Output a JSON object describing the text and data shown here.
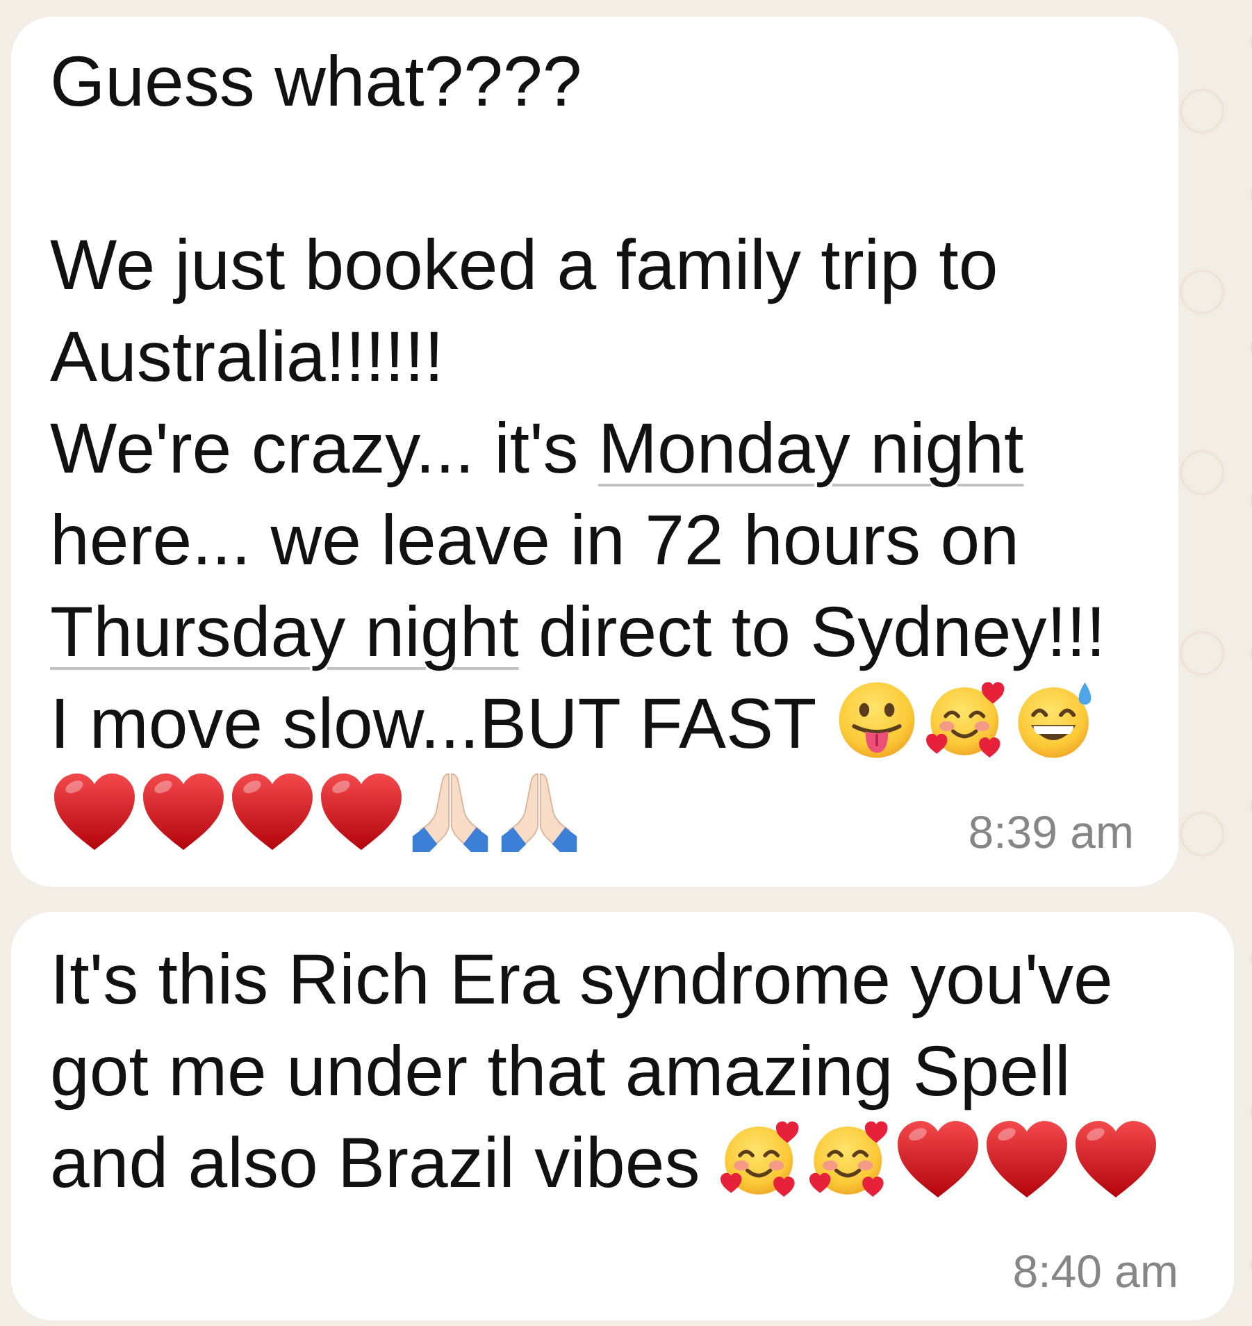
{
  "messages": [
    {
      "paragraphs": [
        {
          "parts": [
            {
              "kind": "text",
              "text": "Guess what????\n\nWe just booked a family trip to Australia!!!!!!\nWe're crazy... it's "
            },
            {
              "kind": "link",
              "text": "Monday night"
            },
            {
              "kind": "text",
              "text": " here... we leave in 72 hours on "
            },
            {
              "kind": "link",
              "text": "Thursday night"
            },
            {
              "kind": "text",
              "text": " direct to Sydney!!!\nI move slow...BUT FAST"
            },
            {
              "kind": "tongue"
            },
            {
              "kind": "hearts"
            },
            {
              "kind": "sweat"
            }
          ]
        },
        {
          "parts": [
            {
              "kind": "heart"
            },
            {
              "kind": "heart"
            },
            {
              "kind": "heart"
            },
            {
              "kind": "heart"
            },
            {
              "kind": "hands"
            },
            {
              "kind": "hands"
            }
          ]
        }
      ],
      "time": "8:39 am"
    },
    {
      "paragraphs": [
        {
          "parts": [
            {
              "kind": "text",
              "text": "It's this Rich Era syndrome you've got me under that amazing Spell and also Brazil vibes"
            },
            {
              "kind": "hearts"
            },
            {
              "kind": "hearts"
            },
            {
              "kind": "heart"
            },
            {
              "kind": "heart"
            },
            {
              "kind": "heart"
            }
          ]
        }
      ],
      "time": "8:40 am"
    }
  ]
}
